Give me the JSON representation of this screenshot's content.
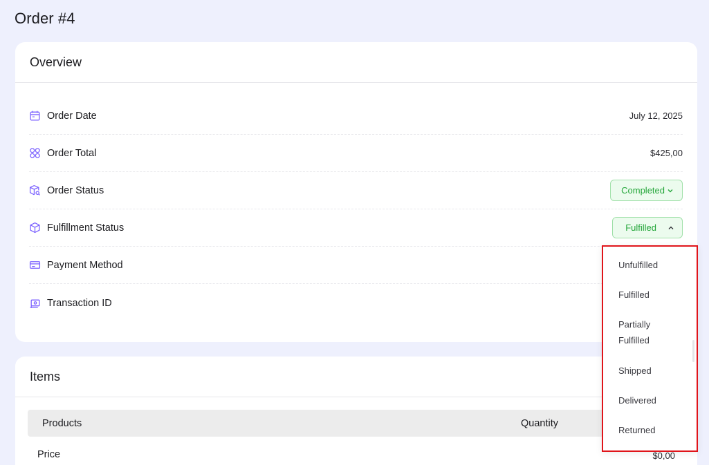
{
  "page": {
    "title": "Order #4"
  },
  "overview": {
    "title": "Overview",
    "rows": [
      {
        "label": "Order Date",
        "icon": "calendar-icon",
        "value": "July 12, 2025"
      },
      {
        "label": "Order Total",
        "icon": "coins-icon",
        "value": "$425,00"
      },
      {
        "label": "Order Status",
        "icon": "box-search-icon",
        "value": "Completed"
      },
      {
        "label": "Fulfillment Status",
        "icon": "box-icon",
        "value": "Fulfilled"
      },
      {
        "label": "Payment Method",
        "icon": "card-icon",
        "value": ""
      },
      {
        "label": "Transaction ID",
        "icon": "receipt-icon",
        "value": ""
      }
    ]
  },
  "items": {
    "title": "Items",
    "columns": {
      "products": "Products",
      "quantity": "Quantity"
    },
    "price_label": "Price",
    "price_value": "$0,00"
  },
  "fulfillment_dropdown": {
    "options": [
      "Unfulfilled",
      "Fulfilled",
      "Partially Fulfilled",
      "Shipped",
      "Delivered",
      "Returned"
    ]
  },
  "colors": {
    "background": "#eef0fd",
    "accent_icon": "#7b61ff",
    "status_green": "#23a639",
    "highlight_border": "#e0141a"
  }
}
